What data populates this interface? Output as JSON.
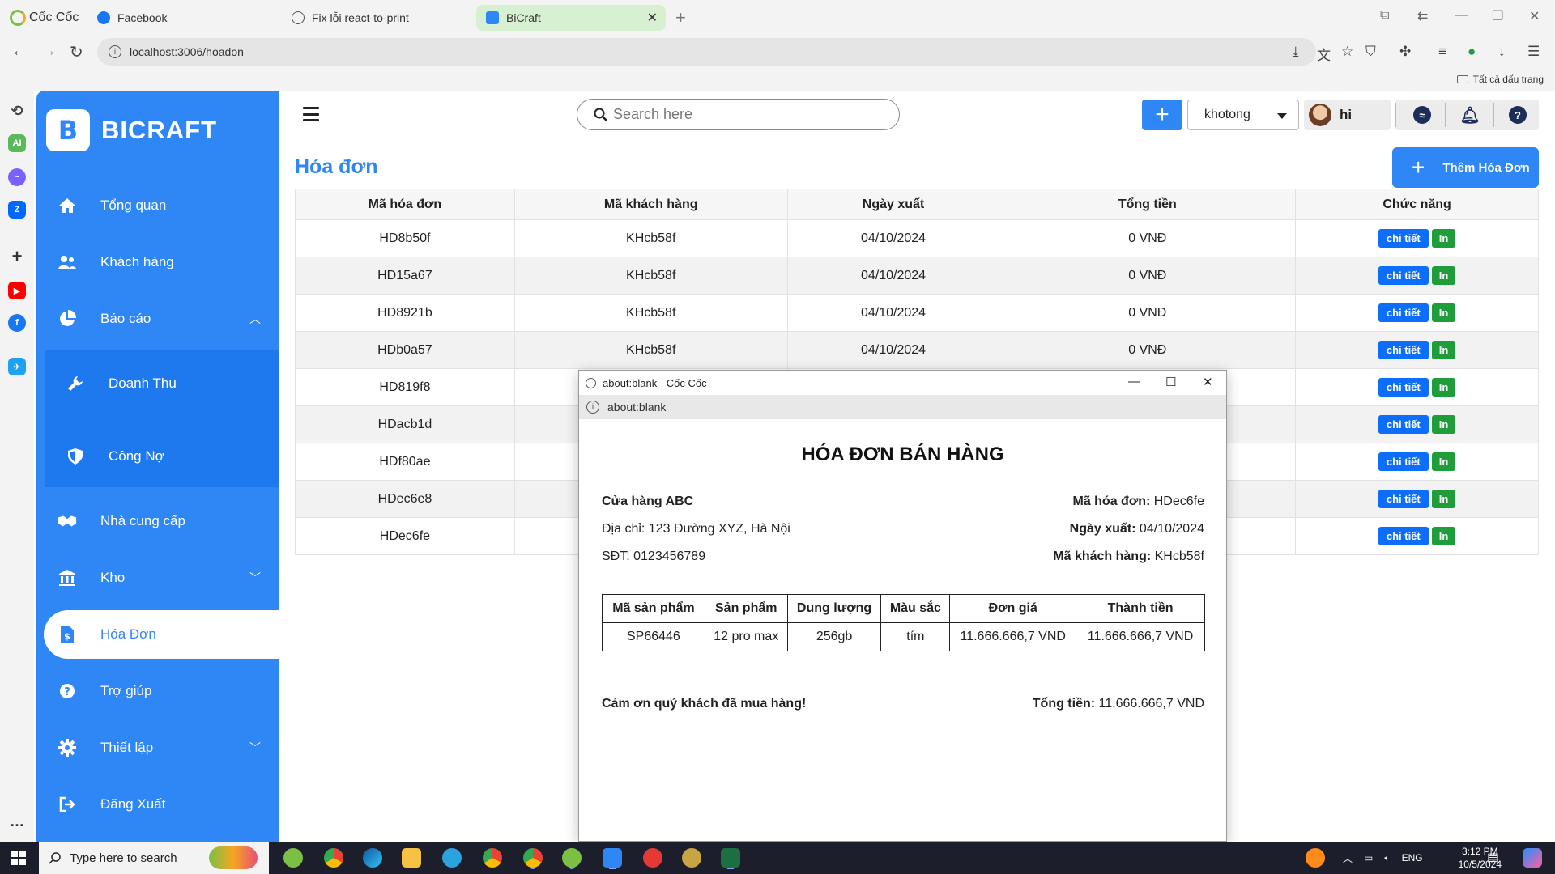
{
  "browser": {
    "brand": "Cốc Cốc",
    "tabs": [
      {
        "label": "Facebook"
      },
      {
        "label": "Fix lỗi react-to-print"
      },
      {
        "label": "BiCraft"
      }
    ],
    "url": "localhost:3006/hoadon",
    "bookmarks_label": "Tất cả dấu trang"
  },
  "app": {
    "brand": "BICRAFT",
    "menu": [
      {
        "label": "Tổng quan",
        "icon": "home-icon"
      },
      {
        "label": "Khách hàng",
        "icon": "users-icon"
      },
      {
        "label": "Báo cáo",
        "icon": "pie-chart-icon"
      },
      {
        "label": "Doanh Thu",
        "icon": "wrench-icon"
      },
      {
        "label": "Công Nợ",
        "icon": "shield-icon"
      },
      {
        "label": "Nhà cung cấp",
        "icon": "handshake-icon"
      },
      {
        "label": "Kho",
        "icon": "warehouse-icon"
      },
      {
        "label": "Hóa Đơn",
        "icon": "invoice-icon"
      },
      {
        "label": "Trợ giúp",
        "icon": "help-icon"
      },
      {
        "label": "Thiết lập",
        "icon": "gear-icon"
      },
      {
        "label": "Đăng Xuất",
        "icon": "logout-icon"
      }
    ],
    "search_placeholder": "Search here",
    "store_select": "khotong",
    "user_name": "hi"
  },
  "page": {
    "title": "Hóa đơn",
    "add_button": "Thêm Hóa Đơn",
    "columns": [
      "Mã hóa đơn",
      "Mã khách hàng",
      "Ngày xuất",
      "Tổng tiền",
      "Chức năng"
    ],
    "detail_label": "chi tiết",
    "print_label": "In",
    "rows": [
      {
        "id": "HD8b50f",
        "customer": "KHcb58f",
        "date": "04/10/2024",
        "total": "0 VNĐ"
      },
      {
        "id": "HD15a67",
        "customer": "KHcb58f",
        "date": "04/10/2024",
        "total": "0 VNĐ"
      },
      {
        "id": "HD8921b",
        "customer": "KHcb58f",
        "date": "04/10/2024",
        "total": "0 VNĐ"
      },
      {
        "id": "HDb0a57",
        "customer": "KHcb58f",
        "date": "04/10/2024",
        "total": "0 VNĐ"
      },
      {
        "id": "HD819f8",
        "customer": "",
        "date": "",
        "total": ""
      },
      {
        "id": "HDacb1d",
        "customer": "",
        "date": "",
        "total": ""
      },
      {
        "id": "HDf80ae",
        "customer": "",
        "date": "",
        "total": ""
      },
      {
        "id": "HDec6e8",
        "customer": "",
        "date": "",
        "total": ""
      },
      {
        "id": "HDec6fe",
        "customer": "",
        "date": "",
        "total": ""
      }
    ]
  },
  "popup": {
    "window_title": "about:blank - Cốc Cốc",
    "url": "about:blank",
    "heading": "HÓA ĐƠN BÁN HÀNG",
    "store_name": "Cửa hàng ABC",
    "address": "Địa chỉ: 123 Đường XYZ, Hà Nội",
    "phone": "SĐT: 0123456789",
    "invoice_id_label": "Mã hóa đơn:",
    "invoice_id": "HDec6fe",
    "date_label": "Ngày xuất:",
    "date": "04/10/2024",
    "customer_label": "Mã khách hàng:",
    "customer": "KHcb58f",
    "item_columns": [
      "Mã sản phẩm",
      "Sản phẩm",
      "Dung lượng",
      "Màu sắc",
      "Đơn giá",
      "Thành tiền"
    ],
    "items": [
      {
        "code": "SP66446",
        "name": "12 pro max",
        "capacity": "256gb",
        "color": "tím",
        "unit_price": "11.666.666,7 VND",
        "amount": "11.666.666,7 VND"
      }
    ],
    "thanks": "Cảm ơn quý khách đã mua hàng!",
    "total_label": "Tổng tiền:",
    "total": "11.666.666,7 VND"
  },
  "taskbar": {
    "search_placeholder": "Type here to search",
    "language": "ENG",
    "time": "3:12 PM",
    "date": "10/5/2024"
  }
}
